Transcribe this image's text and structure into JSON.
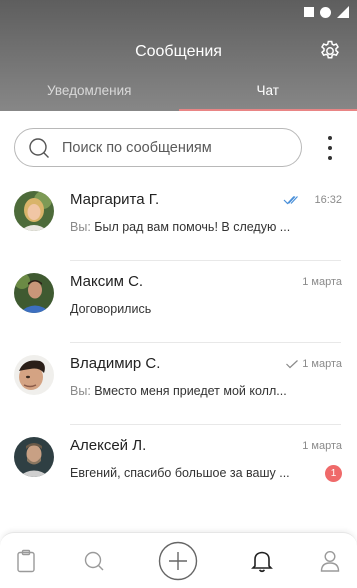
{
  "header": {
    "title": "Сообщения"
  },
  "tabs": [
    {
      "label": "Уведомления",
      "active": false
    },
    {
      "label": "Чат",
      "active": true
    }
  ],
  "search": {
    "placeholder": "Поиск по сообщениям"
  },
  "chats": [
    {
      "name": "Маргарита Г.",
      "time": "16:32",
      "prefix": "Вы: ",
      "message": "Был рад вам помочь! В следую ...",
      "read_status": "double-check-read"
    },
    {
      "name": "Максим С.",
      "time": "1 марта",
      "prefix": "",
      "message": "Договорились"
    },
    {
      "name": "Владимир С.",
      "time": "1 марта",
      "prefix": "Вы: ",
      "message": "Вместо меня приедет мой колл...",
      "read_status": "single-check"
    },
    {
      "name": "Алексей Л.",
      "time": "1 марта",
      "prefix": "",
      "message": "Евгений, спасибо большое за вашу ...",
      "unread_count": "1"
    }
  ],
  "bottom_nav": [
    {
      "icon": "clipboard-icon"
    },
    {
      "icon": "search-icon"
    },
    {
      "icon": "plus-circle-icon"
    },
    {
      "icon": "bell-icon",
      "active": true
    },
    {
      "icon": "profile-icon"
    }
  ],
  "colors": {
    "header_gradient_top": "#5e5e5e",
    "header_gradient_bottom": "#878787",
    "active_tab_underline": "#e98585",
    "read_check": "#4a90d9",
    "badge": "#ef6a6a"
  }
}
